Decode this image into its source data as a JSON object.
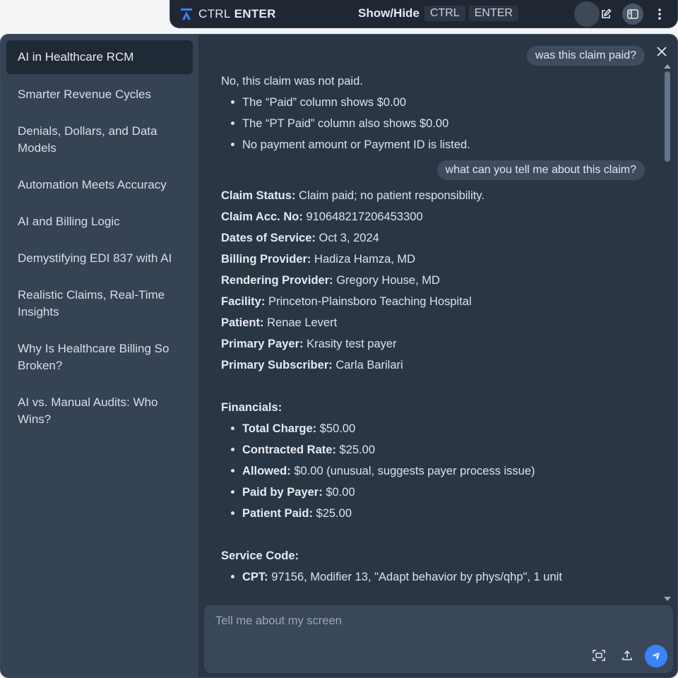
{
  "topbar": {
    "brand_light": "CTRL",
    "brand_bold": "ENTER",
    "showhide_label": "Show/Hide",
    "key1": "CTRL",
    "key2": "ENTER"
  },
  "sidebar": {
    "items": [
      {
        "label": "AI in Healthcare RCM"
      },
      {
        "label": "Smarter Revenue Cycles"
      },
      {
        "label": "Denials, Dollars, and Data Models"
      },
      {
        "label": "Automation Meets Accuracy"
      },
      {
        "label": "AI and Billing Logic"
      },
      {
        "label": "Demystifying EDI 837 with AI"
      },
      {
        "label": "Realistic Claims, Real-Time Insights"
      },
      {
        "label": "Why Is Healthcare Billing So Broken?"
      },
      {
        "label": "AI vs. Manual Audits: Who Wins?"
      }
    ]
  },
  "chat": {
    "q1": "was this claim paid?",
    "a1_intro": "No, this claim was not paid.",
    "a1_bullets": [
      "The “Paid” column shows $0.00",
      "The “PT Paid” column also shows $0.00",
      "No payment amount or Payment ID is listed."
    ],
    "q2": "what can you tell me about this claim?",
    "fields": [
      {
        "label": "Claim Status:",
        "value": "Claim paid; no patient responsibility."
      },
      {
        "label": "Claim Acc. No:",
        "value": "910648217206453300"
      },
      {
        "label": "Dates of Service:",
        "value": "Oct 3, 2024"
      },
      {
        "label": "Billing Provider:",
        "value": "Hadiza Hamza, MD"
      },
      {
        "label": "Rendering Provider:",
        "value": "Gregory House, MD"
      },
      {
        "label": "Facility:",
        "value": "Princeton-Plainsboro Teaching Hospital"
      },
      {
        "label": "Patient:",
        "value": "Renae Levert"
      },
      {
        "label": "Primary Payer:",
        "value": "Krasity test payer"
      },
      {
        "label": "Primary Subscriber:",
        "value": "Carla Barilari"
      }
    ],
    "financials_heading": "Financials:",
    "financials": [
      {
        "label": "Total Charge:",
        "value": "$50.00"
      },
      {
        "label": "Contracted Rate:",
        "value": "$25.00"
      },
      {
        "label": "Allowed:",
        "value": "$0.00 (unusual, suggests payer process issue)"
      },
      {
        "label": "Paid by Payer:",
        "value": "$0.00"
      },
      {
        "label": "Patient Paid:",
        "value": "$25.00"
      }
    ],
    "service_heading": "Service Code:",
    "service": [
      {
        "label": "CPT:",
        "value": "97156, Modifier 13, \"Adapt behavior by phys/qhp\", 1 unit"
      }
    ]
  },
  "composer": {
    "placeholder": "Tell me about my screen"
  },
  "colors": {
    "accent": "#3b82f6",
    "panel_bg": "#2b3645",
    "sidebar_bg": "#364355",
    "active_item_bg": "#202a37"
  },
  "icons": [
    "logo-icon",
    "edit-icon",
    "sidebar-toggle-icon",
    "more-vertical-icon",
    "close-icon",
    "screenshot-icon",
    "upload-icon",
    "send-icon"
  ]
}
